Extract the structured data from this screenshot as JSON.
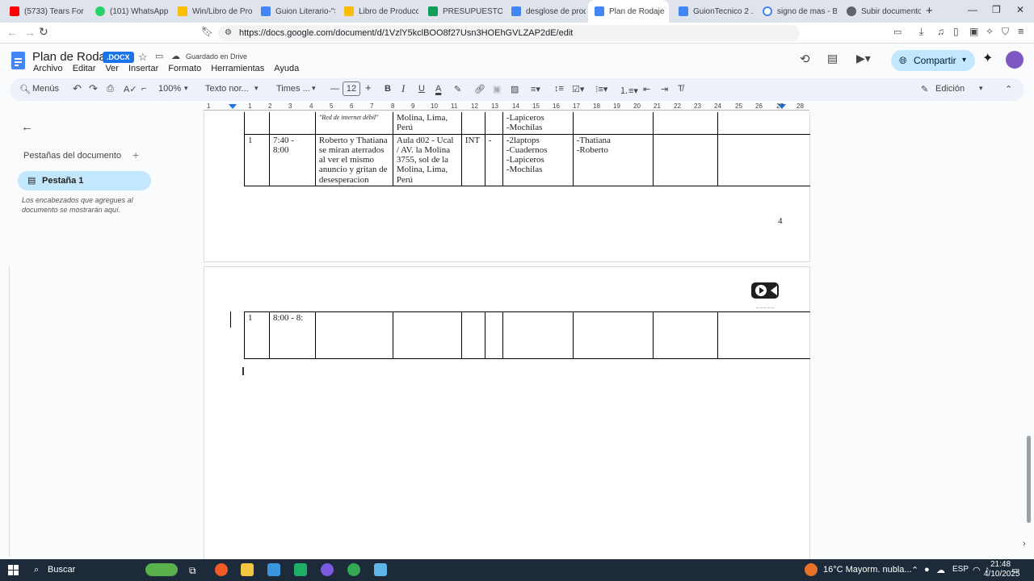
{
  "browser": {
    "tabs": [
      {
        "label": "(5733) Tears For",
        "color": "#ff0000"
      },
      {
        "label": "(101) WhatsApp",
        "color": "#25d366"
      },
      {
        "label": "Win/Libro de Produ",
        "color": "#fbbc04"
      },
      {
        "label": "Guion Literario-\"SU",
        "color": "#4285f4"
      },
      {
        "label": "Libro de Producció",
        "color": "#fbbc04"
      },
      {
        "label": "PRESUPUESTO.xlsx",
        "color": "#0f9d58"
      },
      {
        "label": "desglose de produ",
        "color": "#4285f4"
      },
      {
        "label": "Plan de Rodaje",
        "color": "#4285f4"
      },
      {
        "label": "GuionTecnico 2 .do",
        "color": "#4285f4"
      },
      {
        "label": "signo de mas - Bus",
        "color": "#4285f4"
      },
      {
        "label": "Subir documento a",
        "color": "#5f6368"
      }
    ],
    "url": "https://docs.google.com/document/d/1VzlY5kclBOO8f27Usn3HOEhGVLZAP2dE/edit"
  },
  "doc": {
    "title": "Plan de Rodaje",
    "badge": ".DOCX",
    "saved": "Guardado en Drive",
    "menus": [
      "Archivo",
      "Editar",
      "Ver",
      "Insertar",
      "Formato",
      "Herramientas",
      "Ayuda"
    ],
    "share": "Compartir",
    "toolbar": {
      "menus": "Menús",
      "zoom": "100%",
      "style": "Texto nor...",
      "font": "Times ...",
      "size": "12",
      "mode": "Edición"
    },
    "ruler": [
      "1",
      "1",
      "2",
      "3",
      "4",
      "5",
      "6",
      "7",
      "8",
      "9",
      "10",
      "11",
      "12",
      "13",
      "14",
      "15",
      "16",
      "17",
      "18",
      "19",
      "20",
      "21",
      "22",
      "23",
      "24",
      "25",
      "26",
      "27",
      "28"
    ]
  },
  "sidebar": {
    "heading": "Pestañas del documento",
    "tab": "Pestaña 1",
    "hint": "Los encabezados que agregues al documento se mostrarán aquí."
  },
  "page4": {
    "row_top": {
      "c3": "\"Red de internet débil\"",
      "c4": "Molina, Lima, Perú",
      "c7": "-Lapiceros\n-Mochilas"
    },
    "row": {
      "c1": "1",
      "c2": "7:40 - 8:00",
      "c3": "Roberto y Thatiana se miran aterrados al ver el mismo anuncio y gritan de desesperacion",
      "c4": "Aula d02 - Ucal / AV. la Molina 3755, sol de la Molina, Lima, Perú",
      "c5": "INT",
      "c6": "-",
      "c7": "-2laptops\n-Cuadernos\n-Lapiceros\n-Mochilas",
      "c8": "-Thatiana\n-Roberto"
    },
    "page_number": "4"
  },
  "page5": {
    "row": {
      "c1": "1",
      "c2": "8:00 - 8:"
    }
  },
  "taskbar": {
    "search": "Buscar",
    "weather": "16°C  Mayorm. nubla...",
    "lang": "ESP",
    "time": "21:48",
    "date": "4/10/2025"
  }
}
